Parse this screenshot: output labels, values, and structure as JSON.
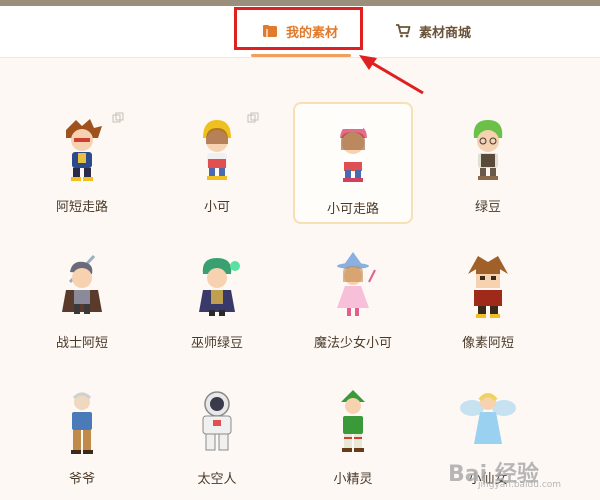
{
  "header": {
    "tabs": [
      {
        "label": "我的素材",
        "icon": "folder-icon",
        "active": true
      },
      {
        "label": "素材商城",
        "icon": "cart-icon",
        "active": false
      }
    ]
  },
  "colors": {
    "accent": "#e07a2c",
    "highlight_box": "#e02020"
  },
  "grid": {
    "rows": [
      [
        {
          "name": "阿短走路"
        },
        {
          "name": "小可"
        },
        {
          "name": "小可走路",
          "selected": true
        },
        {
          "name": "绿豆"
        }
      ],
      [
        {
          "name": "战士阿短"
        },
        {
          "name": "巫师绿豆"
        },
        {
          "name": "魔法少女小可"
        },
        {
          "name": "像素阿短"
        }
      ],
      [
        {
          "name": "爷爷"
        },
        {
          "name": "太空人"
        },
        {
          "name": "小精灵"
        },
        {
          "name": "小仙女"
        }
      ]
    ]
  },
  "watermark": {
    "text": "Bai 经验",
    "sub": "jingyan.baidu.com"
  }
}
